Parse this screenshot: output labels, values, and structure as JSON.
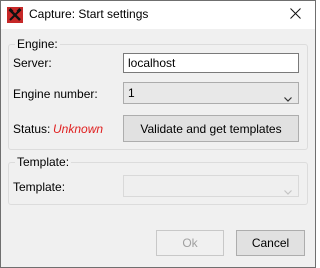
{
  "window": {
    "title": "Capture: Start settings",
    "app_icon": "tools-icon",
    "close_icon": "close-icon"
  },
  "engine_group": {
    "title": "Engine:",
    "server_label": "Server:",
    "server_value": "localhost",
    "engine_number_label": "Engine number:",
    "engine_number_value": "1",
    "status_label": "Status:",
    "status_value": "Unknown",
    "status_color": "#e02020",
    "validate_button_label": "Validate and get templates"
  },
  "template_group": {
    "title": "Template:",
    "template_label": "Template:",
    "template_value": ""
  },
  "footer": {
    "ok_label": "Ok",
    "cancel_label": "Cancel"
  }
}
